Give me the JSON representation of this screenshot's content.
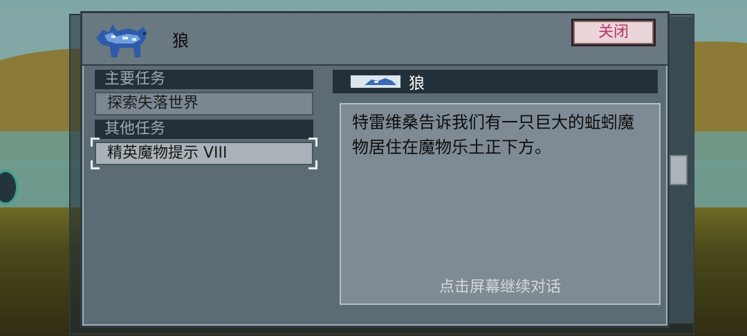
{
  "dialog": {
    "title": "狼",
    "close_label": "关闭"
  },
  "quests": {
    "categories": [
      {
        "label": "主要任务",
        "items": [
          "探索失落世界"
        ]
      },
      {
        "label": "其他任务",
        "items": [
          "精英魔物提示 VIII"
        ]
      }
    ],
    "selected": "精英魔物提示 VIII"
  },
  "detail": {
    "title": "狼",
    "description": "特雷维桑告诉我们有一只巨大的蚯蚓魔物居住在魔物乐土正下方。",
    "continue_hint": "点击屏幕继续对话"
  },
  "icons": {
    "portrait": "wolf-icon",
    "detail": "wolf-mini-icon"
  },
  "colors": {
    "close_text": "#b7346a",
    "panel": "#5d6b75",
    "category_bg": "#243039"
  }
}
